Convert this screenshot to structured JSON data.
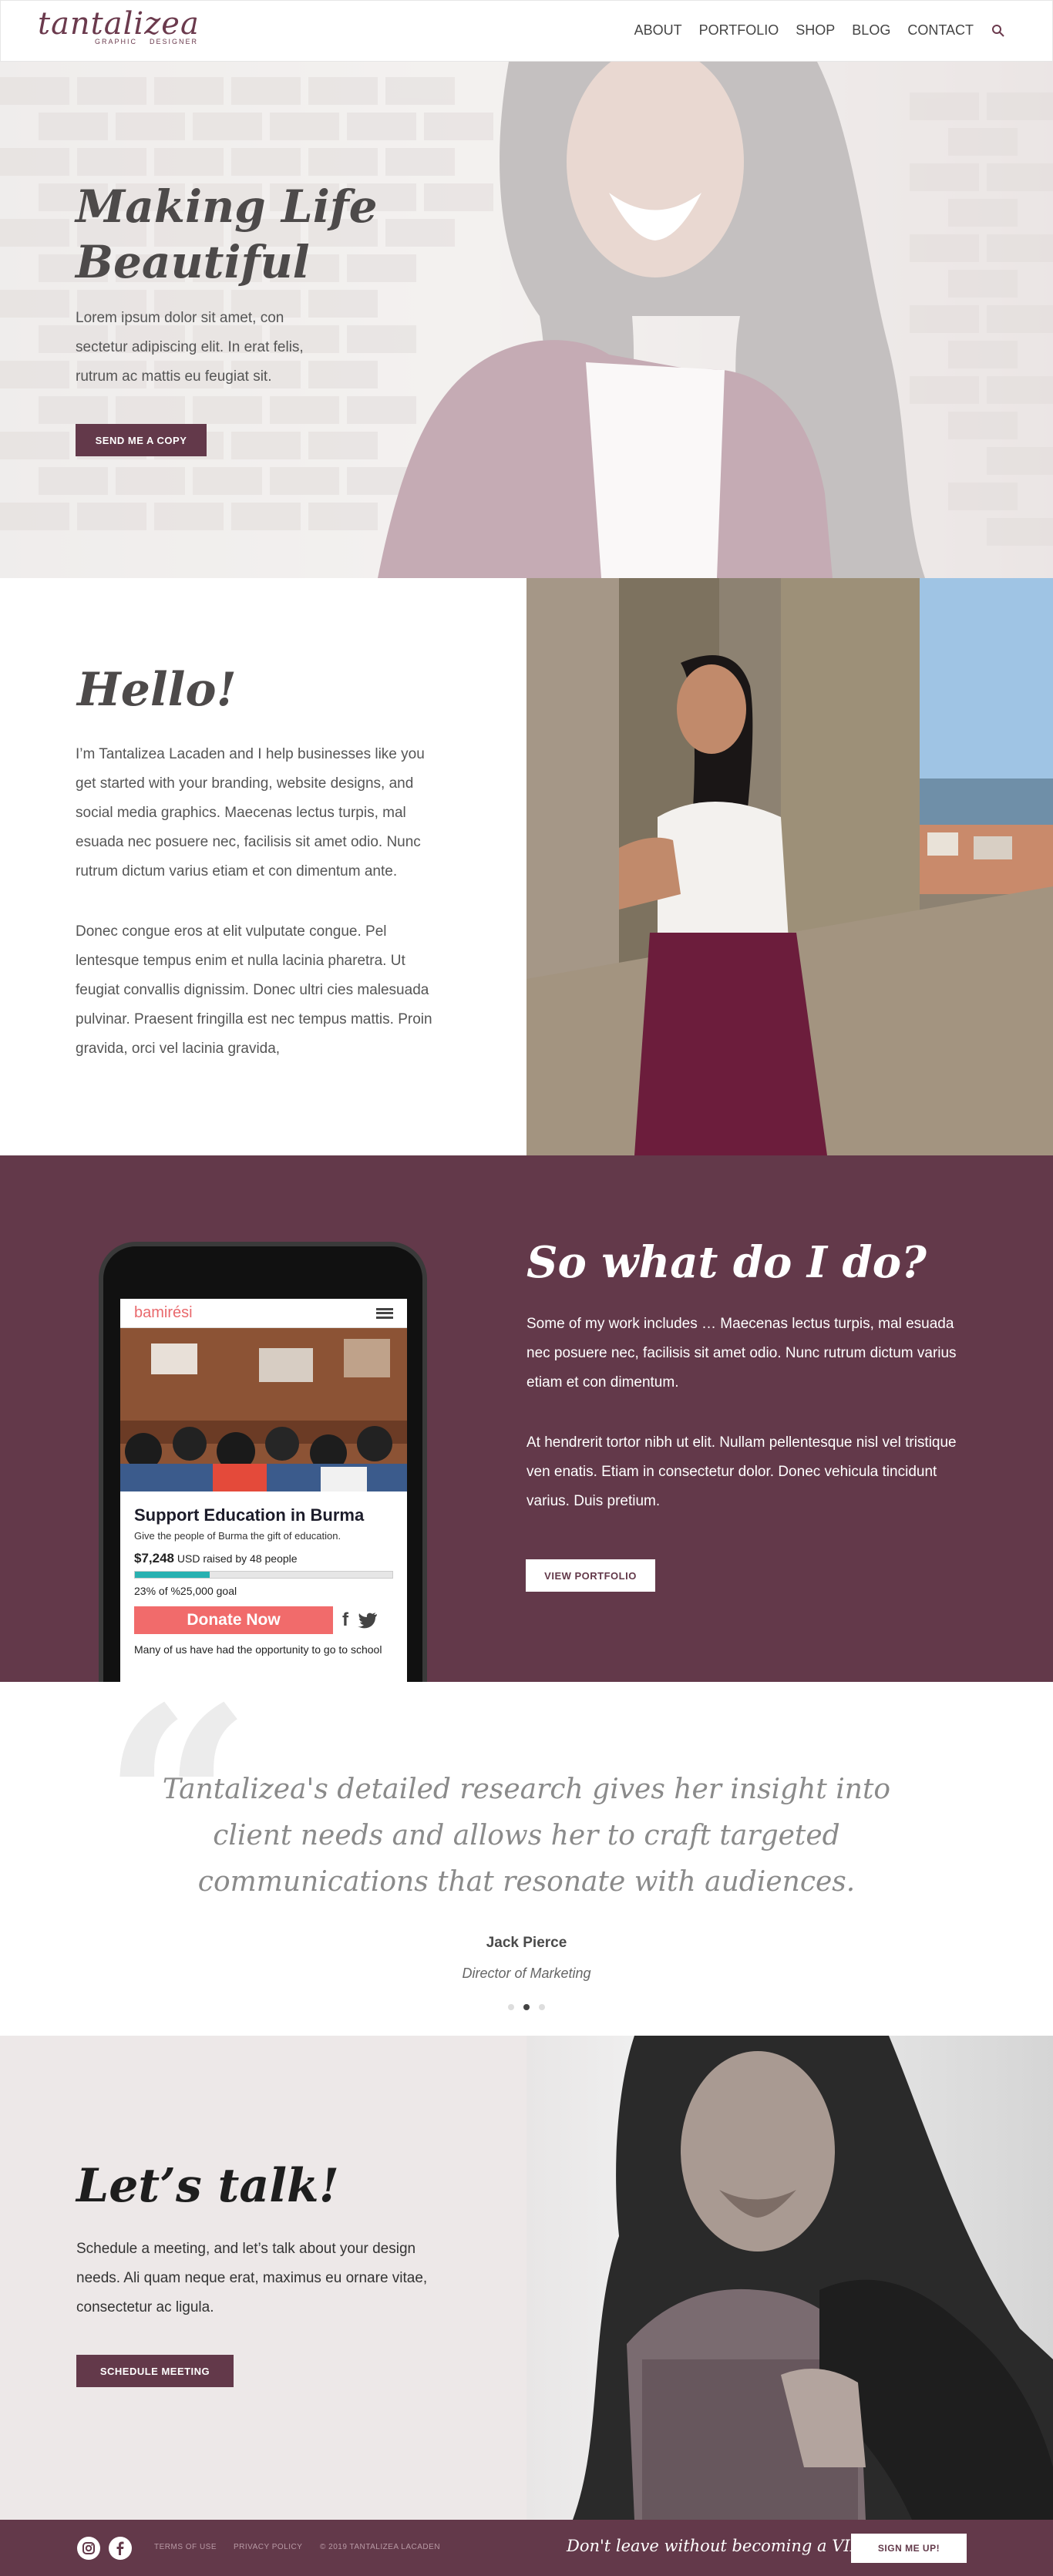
{
  "header": {
    "logo_word": "tantalizea",
    "logo_tag_left": "GRAPHIC",
    "logo_tag_right": "DESIGNER",
    "nav": [
      "ABOUT",
      "PORTFOLIO",
      "SHOP",
      "BLOG",
      "CONTACT"
    ],
    "search_icon": "search-icon"
  },
  "hero": {
    "title": "Making Life Beautiful",
    "text": "Lorem ipsum dolor sit amet, con sectetur adipiscing elit. In erat felis, rutrum ac mattis eu feugiat sit.",
    "button": "SEND ME A COPY"
  },
  "about": {
    "title": "Hello!",
    "paragraph1": "I’m Tantalizea Lacaden and I help businesses like you get started with your branding, website designs, and social media graphics. Maecenas lectus turpis, mal esuada nec posuere nec, facilisis sit amet odio. Nunc rutrum dictum varius etiam et con dimentum ante.",
    "paragraph2": "Donec congue eros at elit vulputate congue. Pel lentesque tempus enim et nulla lacinia pharetra. Ut feugiat convallis dignissim. Donec ultri cies malesuada pulvinar. Praesent fringilla est nec tempus mattis. Proin gravida, orci vel lacinia gravida,"
  },
  "work": {
    "title": "So what do I do?",
    "paragraph1": "Some of my work includes … Maecenas lectus turpis, mal esuada nec posuere nec, facilisis sit amet odio. Nunc rutrum dictum varius etiam et con dimentum.",
    "paragraph2": "At hendrerit tortor nibh ut elit. Nullam pellentesque nisl vel tristique ven enatis. Etiam in consectetur dolor. Donec vehicula tincidunt varius. Duis pretium.",
    "button": "VIEW PORTFOLIO",
    "phone": {
      "app_logo": "bamirési",
      "heading": "Support Education in Burma",
      "subheading": "Give the people of Burma the gift of education.",
      "raised_amount": "$7,248",
      "raised_text": "USD raised by 48 people",
      "progress_fraction": 0.29,
      "goal": "23% of %25,000 goal",
      "donate": "Donate Now",
      "facebook": "f",
      "more_text": "Many of us have had the opportunity to go to school"
    }
  },
  "testimonial": {
    "quote": "Tantalizea's detailed research gives her insight into client needs and allows her to craft targeted communications that resonate with audiences.",
    "name": "Jack Pierce",
    "role": "Director of Marketing",
    "active_slide": 2,
    "slides": 3
  },
  "contact": {
    "title": "Let’s talk!",
    "text": "Schedule a meeting, and let’s talk about your design needs. Ali quam neque erat, maximus eu ornare vitae, consectetur ac ligula.",
    "button": "SCHEDULE MEETING"
  },
  "footer": {
    "terms": "TERMS OF USE",
    "privacy": "PRIVACY POLICY",
    "copyright": "© 2019 TANTALIZEA LACADEN",
    "cta": "Don't leave without becoming a VIP!",
    "button": "SIGN ME UP!"
  },
  "colors": {
    "brand_plum": "#63394a",
    "donate_red": "#f16b6b",
    "progress_teal": "#29b1b1"
  }
}
